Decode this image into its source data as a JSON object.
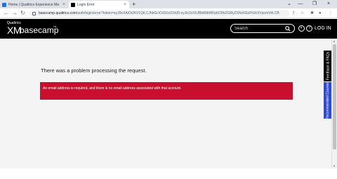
{
  "browser": {
    "tabs": [
      {
        "title": "Home | Qualtrics Experience Ma",
        "close": "×"
      },
      {
        "title": "Login Error",
        "close": "×"
      }
    ],
    "new_tab": "+",
    "window_controls": [
      "⌄",
      "—",
      "❐",
      "×"
    ],
    "nav": {
      "back": "←",
      "forward": "→",
      "reload": "↻"
    },
    "url_host": "basecamp.qualtrics.com",
    "url_path": "/auth/login/error?token=eyJ0eXAiOiJKV1QiLCJhbGciOiJIUzI1NiJ9.eyJtc2ciOiJBbiBlbWFpbCBhZGRyZXNzIGlzIHJlcXVpcmVkLCB",
    "toolbar_icons": [
      "share-icon",
      "star-icon",
      "extensions-icon",
      "profile-icon",
      "menu-icon"
    ]
  },
  "header": {
    "brand_small": "Qualtrics",
    "brand_xm": "XM",
    "brand_name": "basecamp",
    "brand_tm": "TM",
    "search_placeholder": "Search",
    "login_label": "LOG IN"
  },
  "content": {
    "error_title": "There was a problem processing the request.",
    "error_message": "An email address is required, and there is no email address associated with that account."
  },
  "side_tabs": {
    "feedback": "Feedback & FAQs",
    "courses": "Recommended Courses"
  },
  "colors": {
    "header_bg": "#000000",
    "error_red": "#c8102e",
    "courses_blue": "#2f4ad8",
    "content_bg": "#f4f4f4"
  }
}
